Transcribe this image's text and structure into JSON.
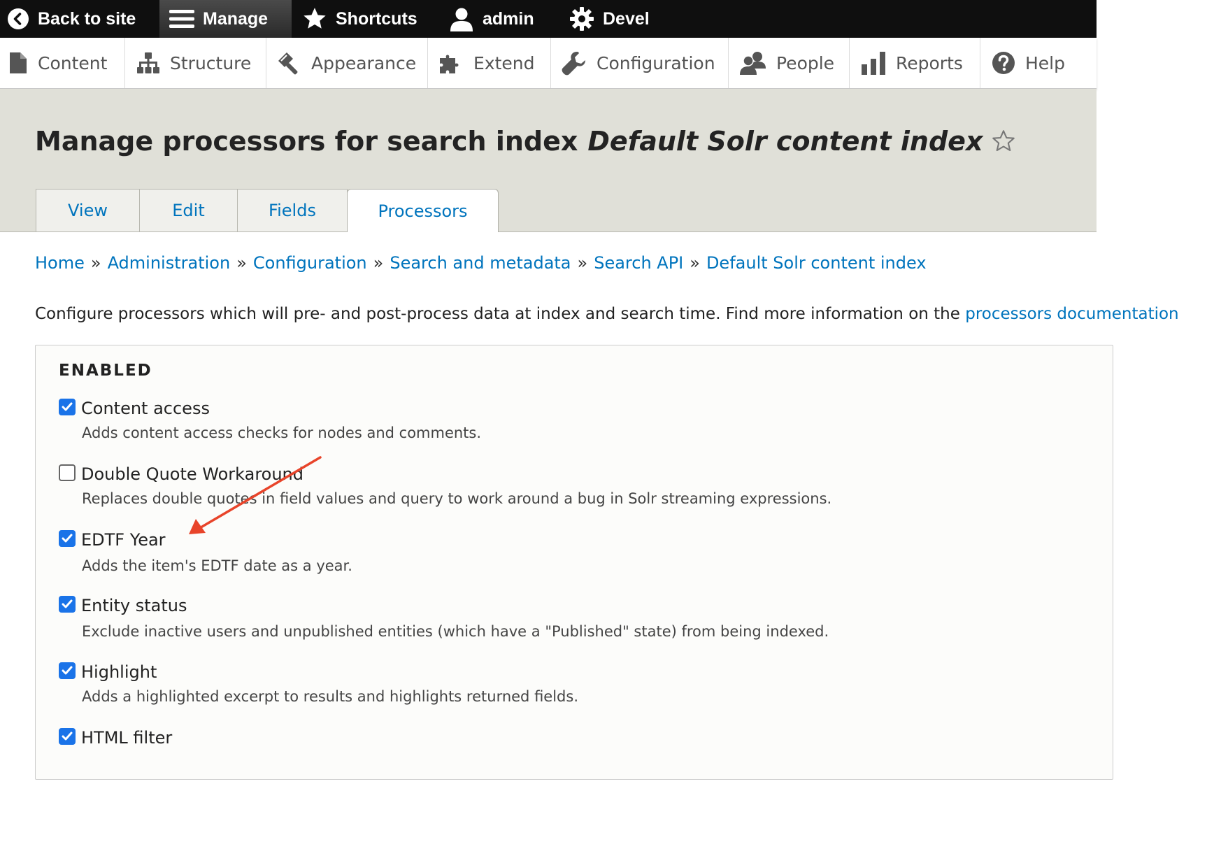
{
  "toolbar": {
    "back_to_site": "Back to site",
    "manage": "Manage",
    "shortcuts": "Shortcuts",
    "user": "admin",
    "devel": "Devel"
  },
  "tray": {
    "items": [
      {
        "label": "Content",
        "icon": "file-icon"
      },
      {
        "label": "Structure",
        "icon": "sitemap-icon"
      },
      {
        "label": "Appearance",
        "icon": "paintbrush-icon"
      },
      {
        "label": "Extend",
        "icon": "puzzle-icon"
      },
      {
        "label": "Configuration",
        "icon": "wrench-icon"
      },
      {
        "label": "People",
        "icon": "people-icon"
      },
      {
        "label": "Reports",
        "icon": "bar-chart-icon"
      },
      {
        "label": "Help",
        "icon": "help-icon"
      }
    ]
  },
  "header": {
    "title_prefix": "Manage processors for search index",
    "title_index": "Default Solr content index",
    "tabs": [
      {
        "label": "View"
      },
      {
        "label": "Edit"
      },
      {
        "label": "Fields"
      },
      {
        "label": "Processors",
        "active": true
      }
    ]
  },
  "breadcrumb": {
    "items": [
      "Home",
      "Administration",
      "Configuration",
      "Search and metadata",
      "Search API",
      "Default Solr content index"
    ],
    "separator": "»"
  },
  "description": {
    "text": "Configure processors which will pre- and post-process data at index and search time. Find more information on the ",
    "link": "processors documentation"
  },
  "enabled": {
    "legend": "ENABLED",
    "processors": [
      {
        "label": "Content access",
        "checked": true,
        "description": "Adds content access checks for nodes and comments."
      },
      {
        "label": "Double Quote Workaround",
        "checked": false,
        "description": "Replaces double quotes in field values and query to work around a bug in Solr streaming expressions."
      },
      {
        "label": "EDTF Year",
        "checked": true,
        "description": "Adds the item's EDTF date as a year."
      },
      {
        "label": "Entity status",
        "checked": true,
        "description": "Exclude inactive users and unpublished entities (which have a \"Published\" state) from being indexed."
      },
      {
        "label": "Highlight",
        "checked": true,
        "description": "Adds a highlighted excerpt to results and highlights returned fields."
      },
      {
        "label": "HTML filter",
        "checked": true,
        "description": ""
      }
    ]
  },
  "annotation": {
    "color": "#e8442a"
  }
}
